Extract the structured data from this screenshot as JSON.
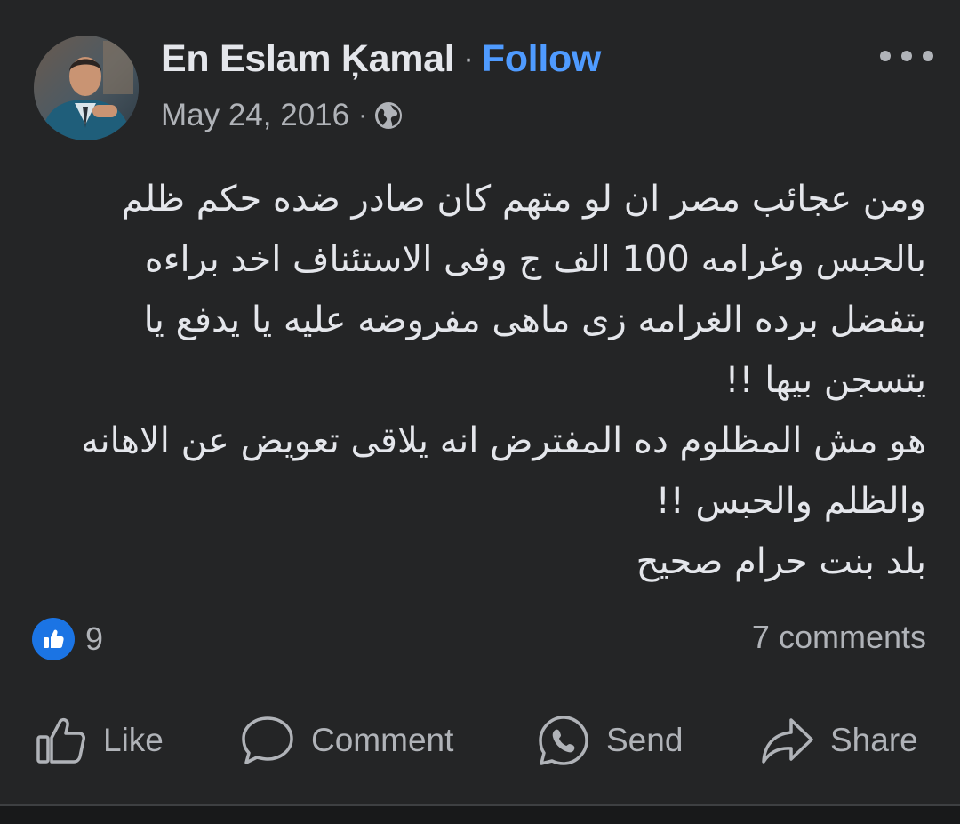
{
  "post": {
    "author": "En Eslam Ķamal",
    "separator": "·",
    "follow_label": "Follow",
    "date": "May 24, 2016",
    "privacy_icon": "globe-icon",
    "more_icon": "more-options-icon",
    "text_lines": [
      "ومن عجائب مصر ان لو متهم كان صادر ضده حكم ظلم",
      "بالحبس وغرامه 100 الف ج وفى الاستئناف اخد براءه",
      "بتفضل برده الغرامه زى ماهى مفروضه عليه يا يدفع يا",
      "يتسجن بيها !!",
      "هو مش المظلوم ده المفترض انه يلاقى تعويض عن الاهانه",
      "والظلم والحبس !!",
      "بلد بنت حرام صحيح"
    ]
  },
  "reactions": {
    "icon": "like-reaction-icon",
    "count": "9",
    "comments_label": "7 comments"
  },
  "actions": {
    "like": "Like",
    "comment": "Comment",
    "send": "Send",
    "share": "Share"
  },
  "colors": {
    "background": "#242526",
    "text": "#e4e6eb",
    "secondary_text": "#b0b3b8",
    "follow_link": "#4f9bff",
    "like_badge": "#1b74e4"
  }
}
